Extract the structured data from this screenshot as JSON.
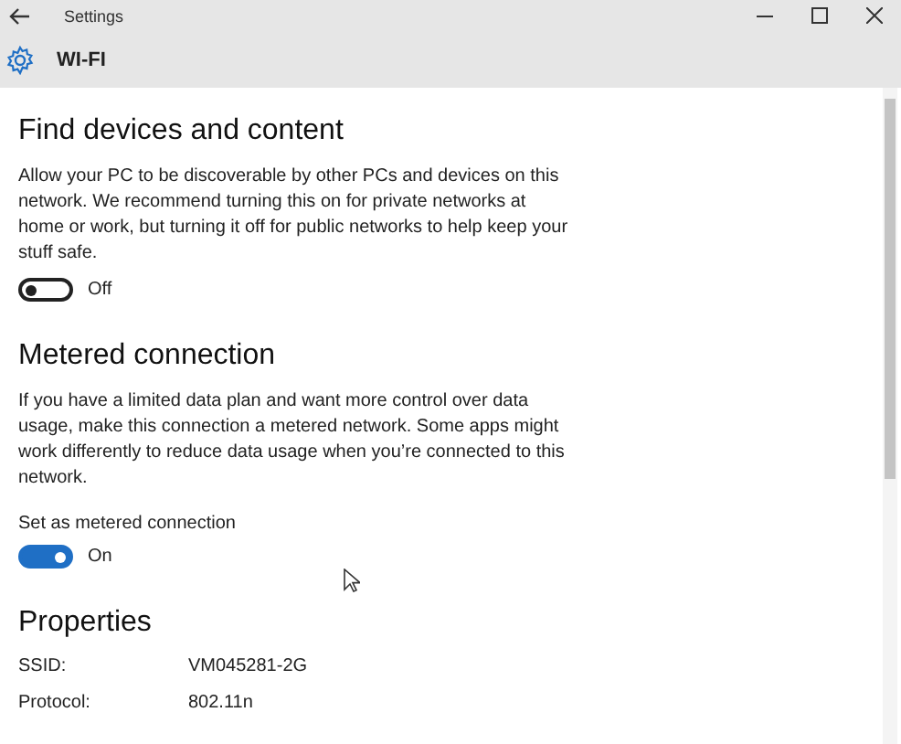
{
  "window": {
    "title": "Settings"
  },
  "header": {
    "title": "WI-FI"
  },
  "sections": [
    {
      "heading": "Find devices and content",
      "description": "Allow your PC to be discoverable by other PCs and devices on this network. We recommend turning this on for private networks at home or work, but turning it off for public networks to help keep your stuff safe.",
      "toggle": {
        "on": false,
        "state_label": "Off"
      }
    },
    {
      "heading": "Metered connection",
      "description": "If you have a limited data plan and want more control over data usage, make this connection a metered network. Some apps might work differently to reduce data usage when you’re connected to this network.",
      "toggle": {
        "label": "Set as metered connection",
        "on": true,
        "state_label": "On"
      }
    }
  ],
  "properties": {
    "heading": "Properties",
    "rows": [
      {
        "label": "SSID:",
        "value": "VM045281-2G"
      },
      {
        "label": "Protocol:",
        "value": "802.11n"
      }
    ]
  }
}
